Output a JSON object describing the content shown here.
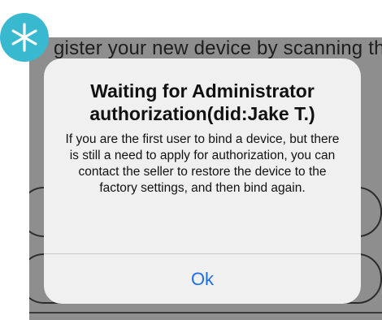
{
  "background": {
    "instruction_text": "gister your new device by scanning the"
  },
  "badge": {
    "icon": "asterisk-icon",
    "color": "#39b9cf"
  },
  "alert": {
    "title": "Waiting for Administrator authorization(did:Jake T.)",
    "message": "If you are the first user to bind a device, but there is still a need to apply for authorization, you can contact the seller to restore the device to the factory settings, and then bind again.",
    "ok_label": "Ok"
  },
  "colors": {
    "accent": "#1e6fe6",
    "dim_overlay": "#8e8e8e",
    "alert_bg": "#f0f0f0"
  }
}
